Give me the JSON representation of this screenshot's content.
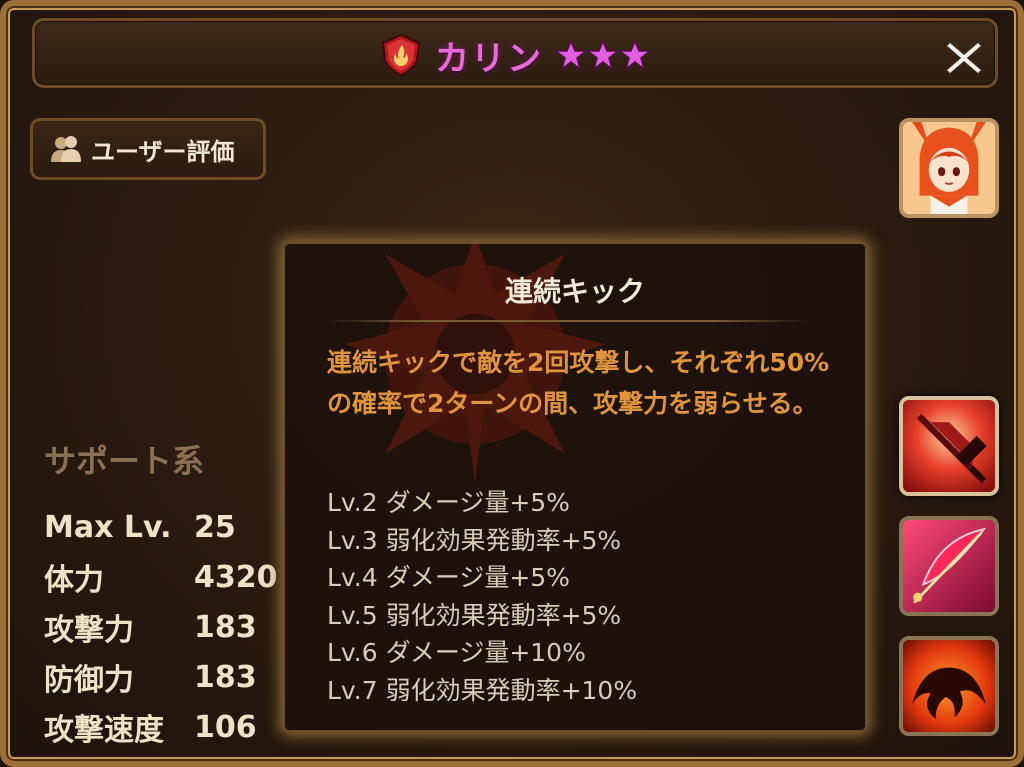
{
  "header": {
    "monster_name": "カリン",
    "element": "fire",
    "star_count": 3,
    "close_icon": "close-icon"
  },
  "rating_button": {
    "label": "ユーザー評価",
    "icon": "users-icon"
  },
  "stats": {
    "type": "サポート系",
    "rows": [
      {
        "label": "Max Lv.",
        "value": "25"
      },
      {
        "label": "体力",
        "value": "4320"
      },
      {
        "label": "攻撃力",
        "value": "183"
      },
      {
        "label": "防御力",
        "value": "183"
      },
      {
        "label": "攻撃速度",
        "value": "106"
      }
    ]
  },
  "tooltip": {
    "skill_name": "連続キック",
    "description": "連続キックで敵を2回攻撃し、それぞれ50%の確率で2ターンの間、攻撃力を弱らせる。",
    "levels": [
      "Lv.2 ダメージ量+5%",
      "Lv.3 弱化効果発動率+5%",
      "Lv.4 ダメージ量+5%",
      "Lv.5 弱化効果発動率+5%",
      "Lv.6 ダメージ量+10%",
      "Lv.7 弱化効果発動率+10%"
    ]
  },
  "colors": {
    "name": "#e86ad8",
    "description": "#e0943c",
    "star": "#e35ee0",
    "stat_type": "#8c7055"
  }
}
